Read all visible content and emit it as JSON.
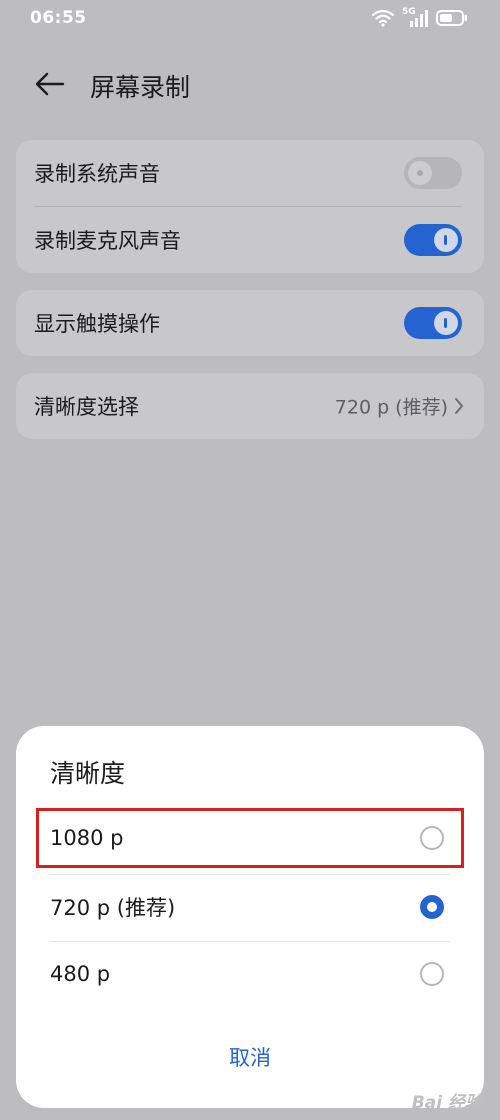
{
  "status_bar": {
    "time": "06:55",
    "network": "5G",
    "icons": [
      "wifi-icon",
      "signal-5g-icon",
      "battery-icon"
    ]
  },
  "header": {
    "back_icon": "back-arrow-icon",
    "title": "屏幕录制"
  },
  "settings": {
    "audio_card": {
      "items": [
        {
          "label": "录制系统声音",
          "toggle_on": false
        },
        {
          "label": "录制麦克风声音",
          "toggle_on": true
        }
      ]
    },
    "touch_card": {
      "items": [
        {
          "label": "显示触摸操作",
          "toggle_on": true
        }
      ]
    },
    "quality_card": {
      "label": "清晰度选择",
      "value": "720 p (推荐)",
      "chevron_icon": "chevron-right-icon"
    }
  },
  "dialog": {
    "title": "清晰度",
    "options": [
      {
        "label": "1080 p",
        "selected": false,
        "highlighted": true
      },
      {
        "label": "720 p (推荐)",
        "selected": true,
        "highlighted": false
      },
      {
        "label": "480 p",
        "selected": false,
        "highlighted": false
      }
    ],
    "cancel_label": "取消"
  },
  "watermark": "Bai 经验",
  "colors": {
    "accent": "#2563d0",
    "overlay_background": "#bdbdc0",
    "card_background": "#c8c8cb",
    "highlight_border": "#d81e1e",
    "sheet_background": "#ffffff"
  }
}
